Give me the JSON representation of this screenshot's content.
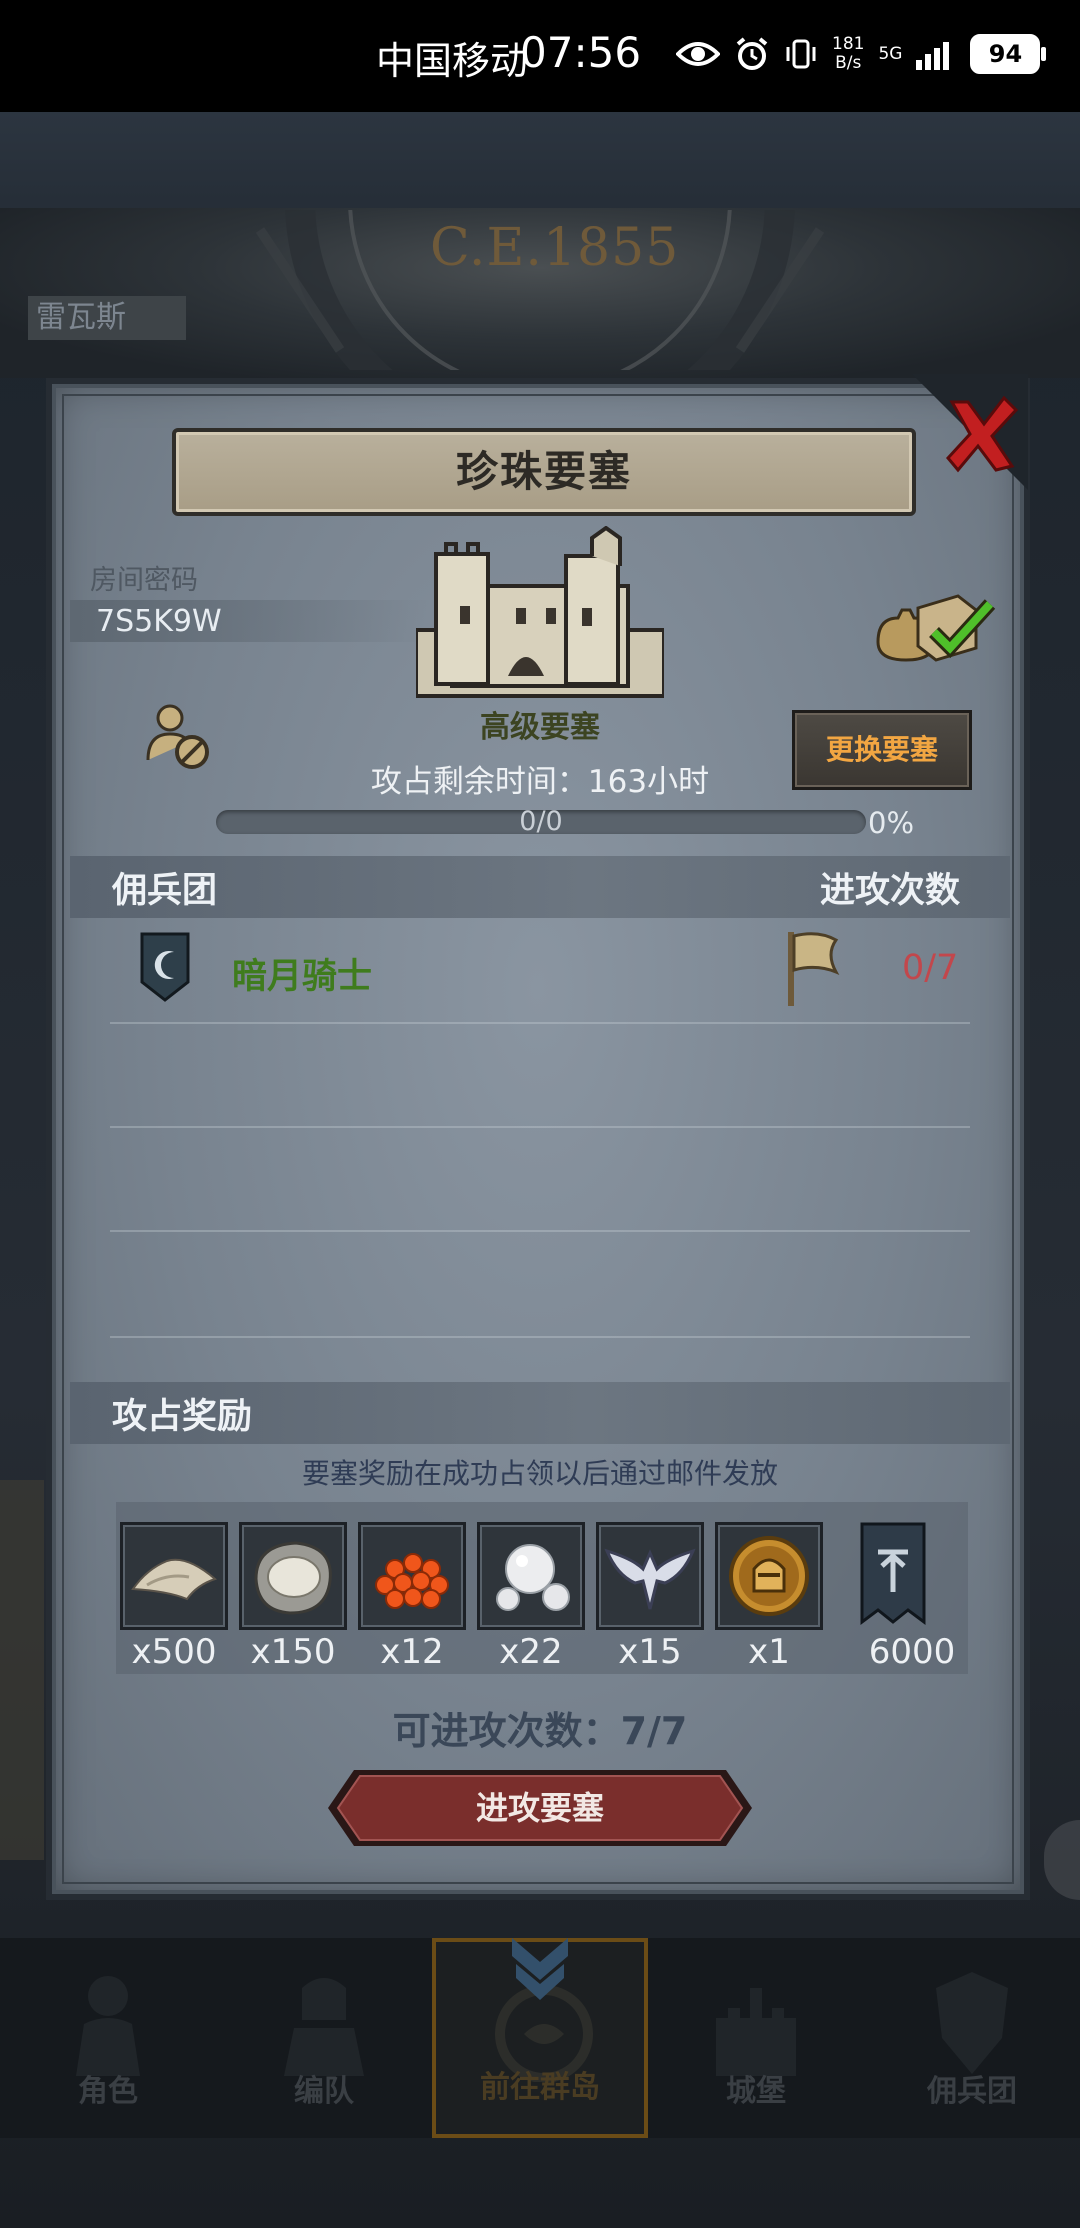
{
  "status_bar": {
    "carrier": "中国移动",
    "time": "07:56",
    "net_speed_value": "181",
    "net_speed_unit": "B/s",
    "network": "5G",
    "battery": "94"
  },
  "background": {
    "year": "C.E.1855",
    "region_label": "雷瓦斯"
  },
  "dialog": {
    "title": "珍珠要塞",
    "room_code_label": "房间密码",
    "room_code": "7S5K9W",
    "fortress_level": "高级要塞",
    "change_button": "更换要塞",
    "time_left": "攻占剩余时间：163小时",
    "progress_count": "0/0",
    "progress_percent": "0%",
    "progress_fraction": 0,
    "mercenary_section_title": "佣兵团",
    "attack_count_header": "进攻次数",
    "mercenaries": [
      {
        "name": "暗月骑士",
        "attacks": "0/7"
      }
    ],
    "reward_section_title": "攻占奖励",
    "reward_note": "要塞奖励在成功占领以后通过邮件发放",
    "rewards": [
      {
        "icon": "sand-pile-icon",
        "qty": "x500"
      },
      {
        "icon": "oyster-icon",
        "qty": "x150"
      },
      {
        "icon": "fish-roe-icon",
        "qty": "x12"
      },
      {
        "icon": "pearl-icon",
        "qty": "x22"
      },
      {
        "icon": "winged-emblem-icon",
        "qty": "x15"
      },
      {
        "icon": "knight-helmet-medal-icon",
        "qty": "x1"
      },
      {
        "icon": "guild-banner-icon",
        "qty": "6000"
      }
    ],
    "attacks_available": "可进攻次数：7/7",
    "attack_button": "进攻要塞"
  },
  "bottom_nav": [
    {
      "label": "角色",
      "icon": "character-icon",
      "active": false
    },
    {
      "label": "编队",
      "icon": "formation-icon",
      "active": false
    },
    {
      "label": "前往群岛",
      "icon": "islands-icon",
      "active": true
    },
    {
      "label": "城堡",
      "icon": "castle-icon",
      "active": false
    },
    {
      "label": "佣兵团",
      "icon": "mercenary-icon",
      "active": false
    }
  ],
  "colors": {
    "change_button_text": "#f2a642",
    "mercenary_name": "#3f7c1d",
    "attack_count": "#c2474c",
    "attack_button": "#7a2e2c"
  }
}
